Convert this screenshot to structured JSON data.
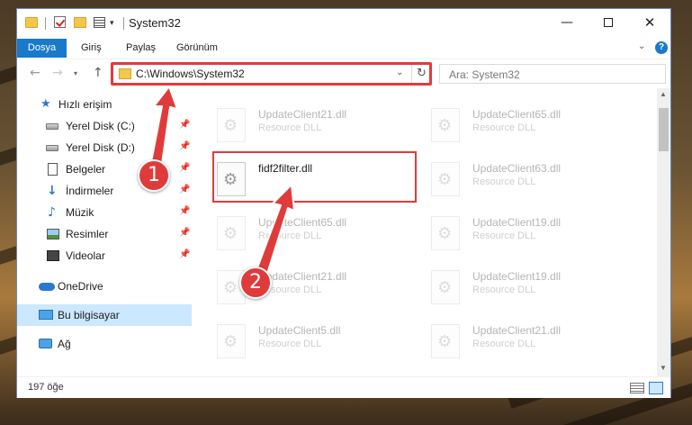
{
  "window": {
    "title": "System32",
    "minimize_glyph": "—",
    "close_glyph": "✕"
  },
  "quick_access_toolbar": {
    "dropdown_glyph": "▾"
  },
  "ribbon": {
    "tabs": [
      {
        "label": "Dosya",
        "active": true
      },
      {
        "label": "Giriş"
      },
      {
        "label": "Paylaş"
      },
      {
        "label": "Görünüm"
      }
    ],
    "expand_glyph": "⌄",
    "help_glyph": "?"
  },
  "navigation": {
    "back_glyph": "←",
    "forward_glyph": "→",
    "recent_glyph": "▾",
    "up_glyph": "↑",
    "address": "C:\\Windows\\System32",
    "address_dropdown_glyph": "⌄",
    "refresh_glyph": "↻",
    "search_placeholder": "Ara: System32"
  },
  "sidebar": {
    "pin_glyph": "📌",
    "items": [
      {
        "label": "Hızlı erişim",
        "icon": "star-icon",
        "glyph": "★"
      },
      {
        "label": "Yerel Disk (C:)",
        "icon": "drive-icon",
        "pinned": true
      },
      {
        "label": "Yerel Disk (D:)",
        "icon": "drive-icon",
        "pinned": true
      },
      {
        "label": "Belgeler",
        "icon": "document-icon",
        "pinned": true
      },
      {
        "label": "İndirmeler",
        "icon": "download-icon",
        "glyph": "↓",
        "pinned": true
      },
      {
        "label": "Müzik",
        "icon": "music-icon",
        "glyph": "♪",
        "pinned": true
      },
      {
        "label": "Resimler",
        "icon": "pictures-icon",
        "pinned": true
      },
      {
        "label": "Videolar",
        "icon": "video-icon",
        "pinned": true
      },
      {
        "label": "OneDrive",
        "icon": "cloud-icon"
      },
      {
        "label": "Bu bilgisayar",
        "icon": "computer-icon",
        "selected": true
      },
      {
        "label": "Ağ",
        "icon": "network-icon"
      }
    ]
  },
  "files": [
    {
      "name": "UpdateClient21.dll",
      "type": "Resource DLL"
    },
    {
      "name": "UpdateClient65.dll",
      "type": "Resource DLL"
    },
    {
      "name": "fidf2filter.dll",
      "type": ""
    },
    {
      "name": "UpdateClient63.dll",
      "type": "Resource DLL"
    },
    {
      "name": "UpdateClient65.dll",
      "type": "Resource DLL"
    },
    {
      "name": "UpdateClient19.dll",
      "type": "Resource DLL"
    },
    {
      "name": "UpdateClient21.dll",
      "type": "Resource DLL"
    },
    {
      "name": "UpdateClient19.dll",
      "type": "Resource DLL"
    },
    {
      "name": "UpdateClient5.dll",
      "type": "Resource DLL"
    },
    {
      "name": "UpdateClient21.dll",
      "type": "Resource DLL"
    }
  ],
  "scrollbar": {
    "up_glyph": "▲",
    "down_glyph": "▼"
  },
  "status": {
    "item_count": "197 öğe"
  },
  "annotations": {
    "callout_1": "1",
    "callout_2": "2",
    "color": "#e03b3b"
  }
}
